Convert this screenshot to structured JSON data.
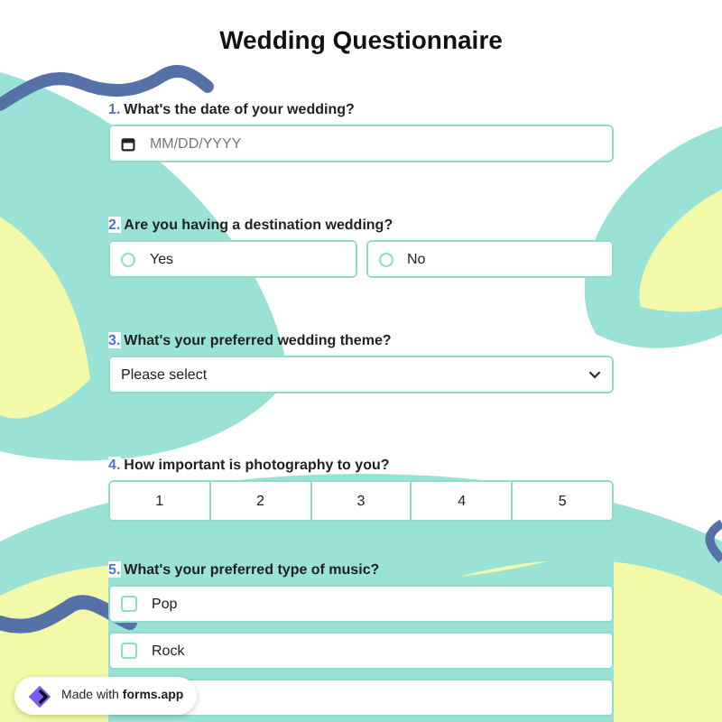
{
  "title": "Wedding Questionnaire",
  "questions": [
    {
      "number": "1.",
      "label": "What's the date of your wedding?",
      "kind": "date",
      "placeholder": "MM/DD/YYYY"
    },
    {
      "number": "2.",
      "label": "Are you having a destination wedding?",
      "kind": "radio",
      "options": [
        {
          "label": "Yes",
          "selected": false
        },
        {
          "label": "No",
          "selected": false
        }
      ]
    },
    {
      "number": "3.",
      "label": "What's your preferred wedding theme?",
      "kind": "select",
      "value": "Please select"
    },
    {
      "number": "4.",
      "label": "How important is photography to you?",
      "kind": "scale",
      "options": [
        {
          "label": "1",
          "selected": false
        },
        {
          "label": "2",
          "selected": false
        },
        {
          "label": "3",
          "selected": false
        },
        {
          "label": "4",
          "selected": false
        },
        {
          "label": "5",
          "selected": false
        }
      ]
    },
    {
      "number": "5.",
      "label": "What's your preferred type of music?",
      "kind": "checkbox",
      "options": [
        {
          "label": "Pop",
          "checked": false
        },
        {
          "label": "Rock",
          "checked": false
        },
        {
          "covered": true
        }
      ]
    }
  ],
  "badge": {
    "prefix": "Made with",
    "brand": "forms.app"
  }
}
